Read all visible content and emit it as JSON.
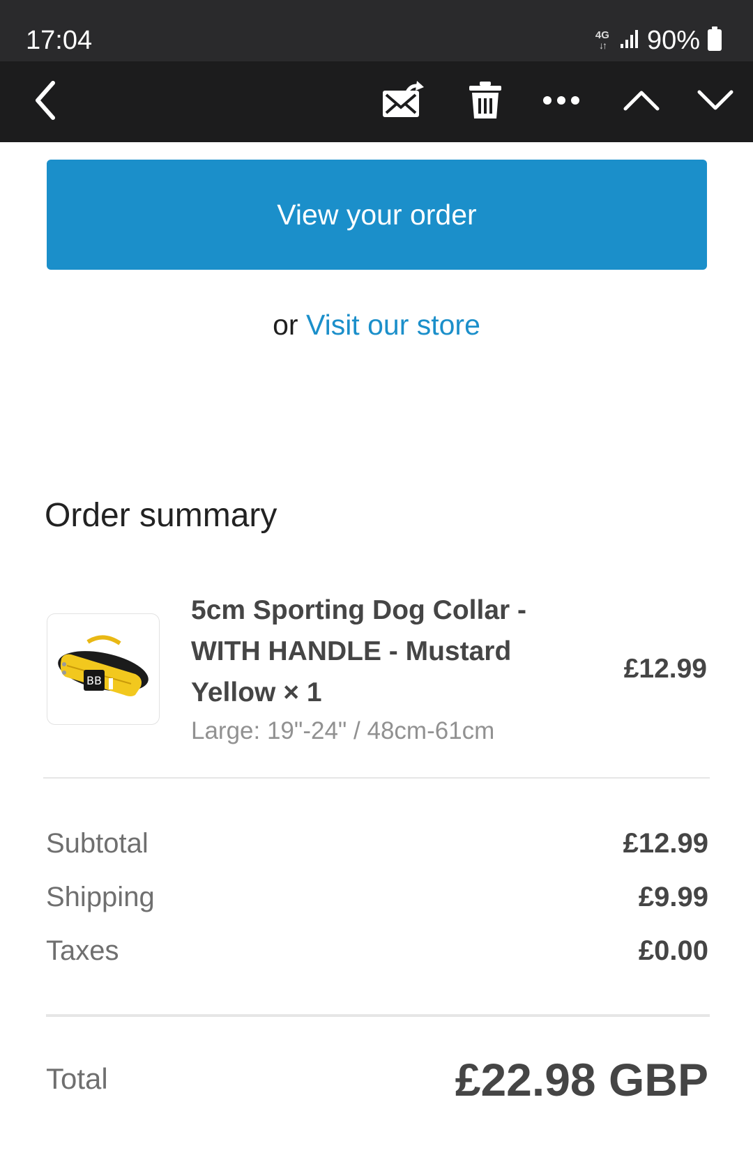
{
  "status_bar": {
    "time": "17:04",
    "network": "4G",
    "network_arrows": "↓↑",
    "battery": "90%"
  },
  "toolbar": {
    "icons": [
      "back-icon",
      "mark-unread-icon",
      "trash-icon",
      "more-icon",
      "chevron-up-icon",
      "chevron-down-icon"
    ]
  },
  "actions": {
    "view_order_label": "View your order",
    "or_text": "or",
    "visit_store_label": "Visit our store"
  },
  "order_summary": {
    "title": "Order summary",
    "item": {
      "title_lines": [
        "5cm Sporting Dog Collar -",
        "WITH HANDLE - Mustard",
        "Yellow × 1"
      ],
      "variant": "Large: 19\"-24\" / 48cm-61cm",
      "price": "£12.99"
    },
    "lines": [
      {
        "label": "Subtotal",
        "value": "£12.99"
      },
      {
        "label": "Shipping",
        "value": "£9.99"
      },
      {
        "label": "Taxes",
        "value": "£0.00"
      }
    ],
    "total_label": "Total",
    "total_value": "£22.98 GBP"
  },
  "colors": {
    "accent": "#1b8fca",
    "status_bar": "#2a2a2c",
    "toolbar": "#1c1c1d",
    "collar": "#f2c81e"
  }
}
